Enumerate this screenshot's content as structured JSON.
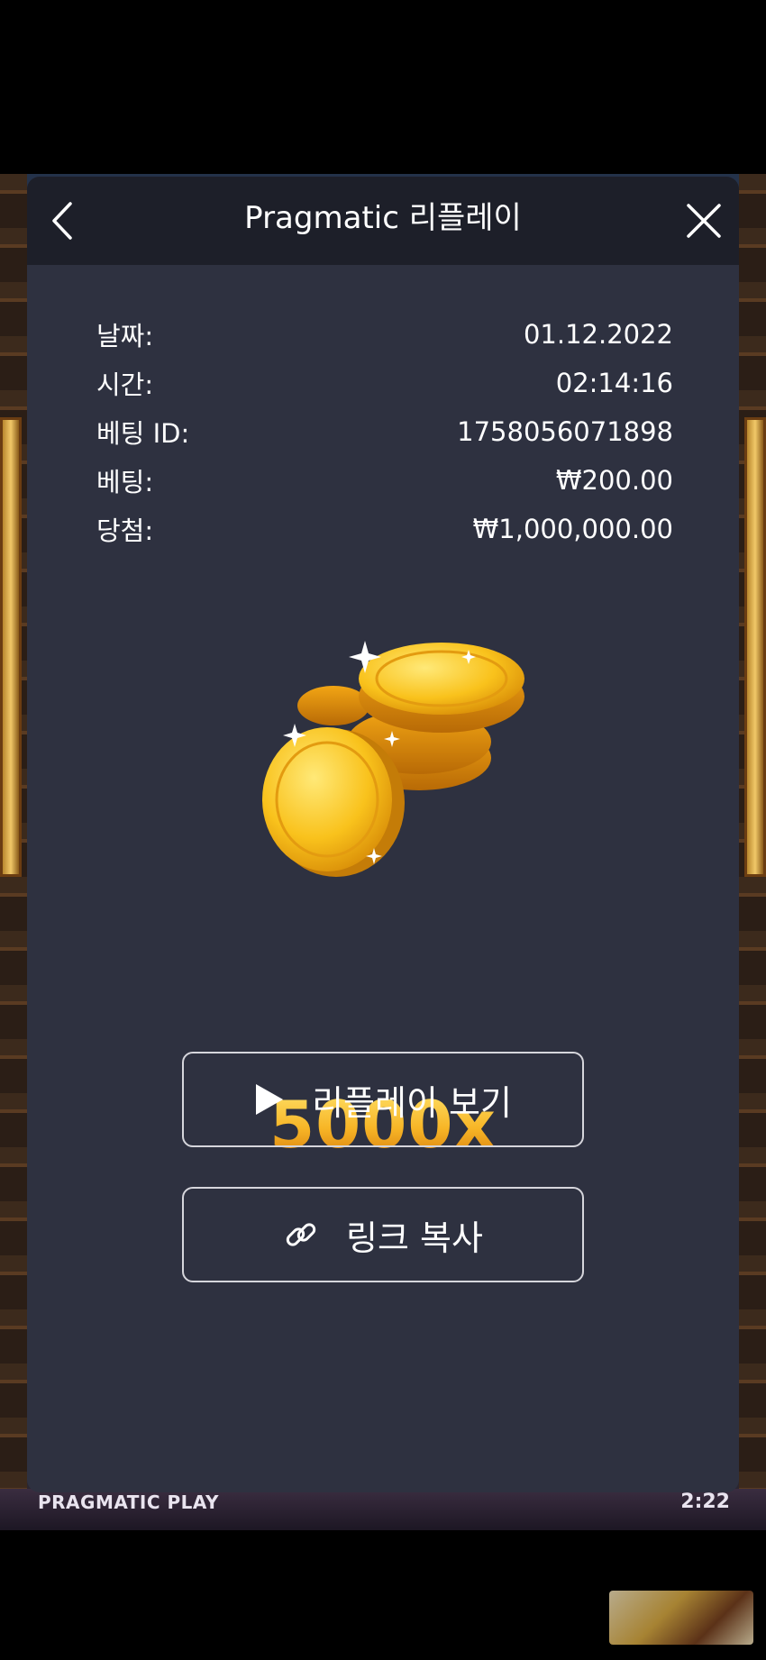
{
  "modal": {
    "title": "Pragmatic 리플레이",
    "back_icon": "chevron-left-icon",
    "close_icon": "close-icon"
  },
  "details": [
    {
      "label": "날짜:",
      "value": "01.12.2022"
    },
    {
      "label": "시간:",
      "value": "02:14:16"
    },
    {
      "label": "베팅 ID:",
      "value": "1758056071898"
    },
    {
      "label": "베팅:",
      "value": "₩200.00"
    },
    {
      "label": "당첨:",
      "value": "₩1,000,000.00"
    }
  ],
  "multiplier": "5000x",
  "buttons": {
    "replay_label": "리플레이 보기",
    "replay_icon": "play-icon",
    "copy_label": "링크 복사",
    "copy_icon": "link-icon"
  },
  "background": {
    "provider": "PRAGMATIC PLAY",
    "clock": "2:22"
  },
  "colors": {
    "modal_bg": "#2e3140",
    "header_bg": "#1d1f29",
    "multiplier_gold": "#f4a91e"
  }
}
